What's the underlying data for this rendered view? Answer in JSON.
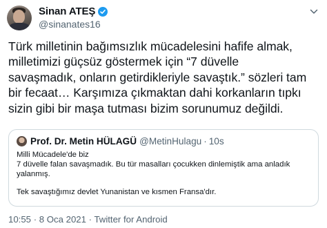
{
  "author": {
    "name": "Sinan ATEŞ",
    "handle": "@sinanates16",
    "verified": true
  },
  "tweet": {
    "lines": [
      "Türk milletinin bağımsızlık mücadelesini hafife almak,",
      "milletimizi güçsüz göstermek için “7 düvelle",
      "savaşmadık, onların getirdikleriyle savaştık.” sözleri tam",
      "bir fecaat… Karşımıza çıkmaktan dahi korkanların tıpkı",
      "sizin gibi bir maşa tutması bizim sorunumuz değildi."
    ]
  },
  "quoted_tweet": {
    "name": "Prof. Dr. Metin HÜLAGÜ",
    "handle": "@MetinHulagu",
    "separator": "·",
    "time": "10s",
    "lines": [
      "Milli Mücadele'de biz",
      "7 düvelle falan savaşmadık. Bu tür masalları çocukken dinlemiştik ama anladık",
      "yalanmış."
    ],
    "last_line": "Tek savaştığımız devlet Yunanistan ve kısmen Fransa'dır."
  },
  "meta": {
    "time": "10:55",
    "separator": "·",
    "date": "8 Oca 2021",
    "source": "Twitter for Android"
  },
  "colors": {
    "verified": "#1d9bf0",
    "secondary_text": "#536471",
    "border": "#cfd9de"
  },
  "icons": {
    "verified": "verified-badge-icon",
    "more": "chevron-down-icon"
  }
}
